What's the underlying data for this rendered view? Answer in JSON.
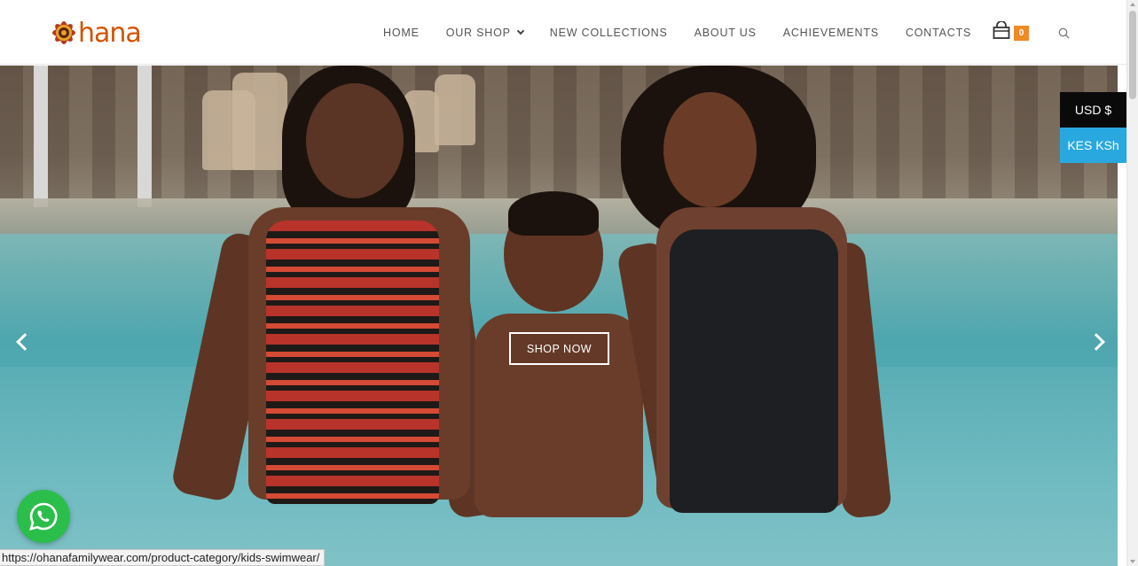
{
  "brand": {
    "logo_text": "hana",
    "logo_color": "#d35400"
  },
  "nav": {
    "items": [
      {
        "label": "HOME"
      },
      {
        "label": "OUR SHOP",
        "has_dropdown": true
      },
      {
        "label": "NEW COLLECTIONS"
      },
      {
        "label": "ABOUT US"
      },
      {
        "label": "ACHIEVEMENTS"
      },
      {
        "label": "CONTACTS"
      }
    ],
    "cart_count": "0",
    "cart_icon": "shopping-bag-icon",
    "search_icon": "search-icon"
  },
  "hero": {
    "cta_label": "SHOP NOW",
    "prev_icon": "chevron-left-icon",
    "next_icon": "chevron-right-icon"
  },
  "currency": {
    "options": [
      {
        "label": "USD $",
        "color": "#0a0a0a"
      },
      {
        "label": "KES KSh",
        "color": "#29a8e0"
      }
    ]
  },
  "whatsapp": {
    "icon": "whatsapp-icon",
    "color": "#2bbe4b"
  },
  "status_bar": {
    "url": "https://ohanafamilywear.com/product-category/kids-swimwear/"
  },
  "colors": {
    "badge": "#f08a24"
  }
}
